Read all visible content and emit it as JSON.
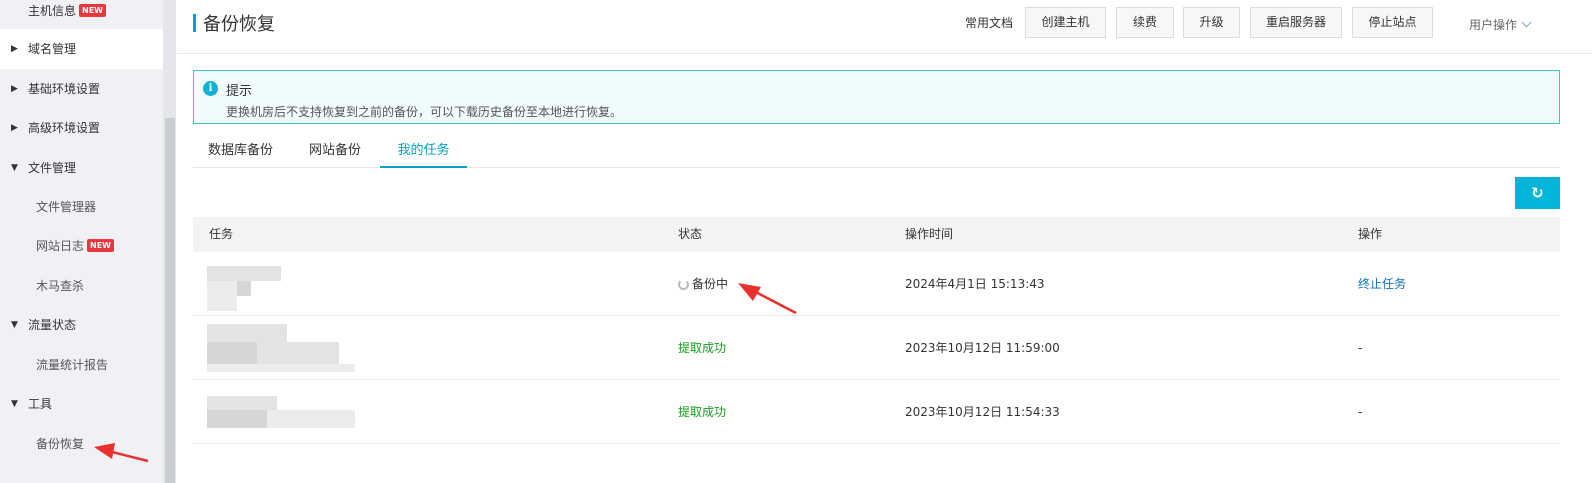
{
  "sidebar": {
    "items": [
      {
        "label": "主机信息",
        "badge": "NEW",
        "caret": "none"
      },
      {
        "label": "域名管理",
        "caret": "right"
      },
      {
        "label": "基础环境设置",
        "caret": "right"
      },
      {
        "label": "高级环境设置",
        "caret": "right"
      },
      {
        "label": "文件管理",
        "caret": "down"
      },
      {
        "label": "文件管理器"
      },
      {
        "label": "网站日志",
        "badge": "NEW"
      },
      {
        "label": "木马查杀"
      },
      {
        "label": "流量状态",
        "caret": "down"
      },
      {
        "label": "流量统计报告"
      },
      {
        "label": "工具",
        "caret": "down"
      },
      {
        "label": "备份恢复"
      }
    ]
  },
  "header": {
    "title": "备份恢复",
    "doc_link": "常用文档",
    "buttons": [
      "创建主机",
      "续费",
      "升级",
      "重启服务器",
      "停止站点"
    ],
    "user_menu": "用户操作"
  },
  "notice": {
    "title": "提示",
    "text": "更换机房后不支持恢复到之前的备份，可以下载历史备份至本地进行恢复。"
  },
  "tabs": [
    "数据库备份",
    "网站备份",
    "我的任务"
  ],
  "active_tab": "我的任务",
  "table": {
    "columns": [
      "任务",
      "状态",
      "操作时间",
      "操作"
    ],
    "rows": [
      {
        "status": "备份中",
        "time": "2024年4月1日 15:13:43",
        "action": "终止任务"
      },
      {
        "status": "提取成功",
        "time": "2023年10月12日 11:59:00",
        "action": "-"
      },
      {
        "status": "提取成功",
        "time": "2023年10月12日 11:54:33",
        "action": "-"
      }
    ]
  },
  "colors": {
    "accent": "#00a2ca",
    "success": "#1b9e23",
    "link": "#0b6fc4",
    "annotation_arrow": "#e8312c",
    "badge": "#e4393c"
  },
  "icons": {
    "refresh": "refresh-icon",
    "info": "info-icon",
    "caret_right": "caret-right-icon",
    "caret_down": "caret-down-icon"
  }
}
